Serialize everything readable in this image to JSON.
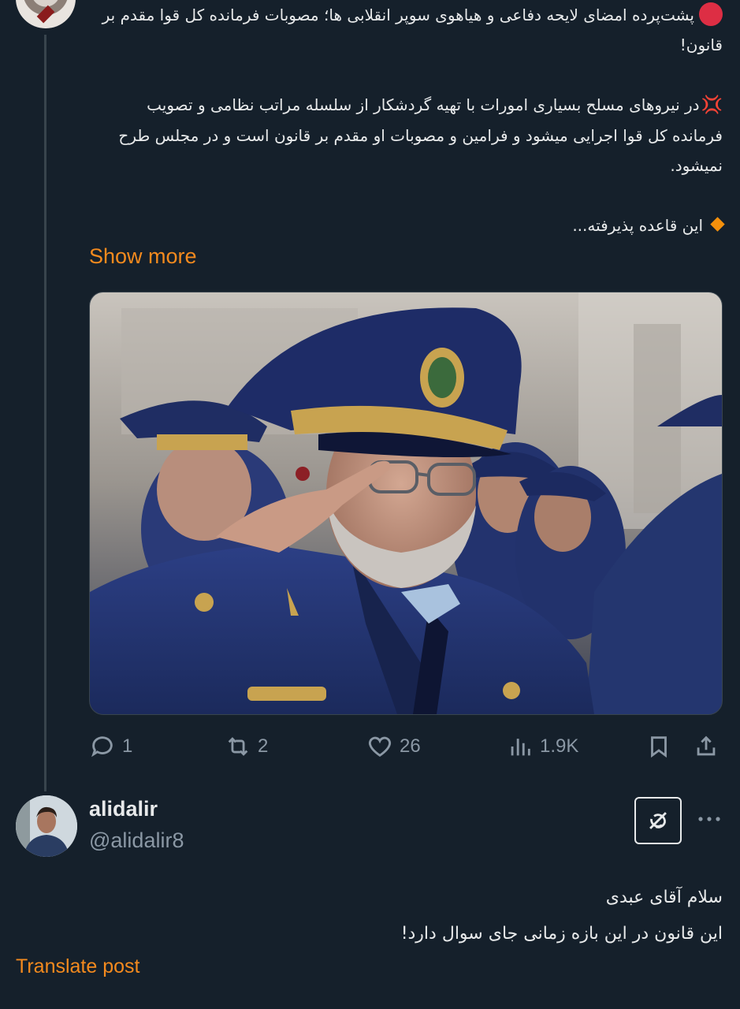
{
  "colors": {
    "background": "#15202b",
    "text": "#e7e9ea",
    "muted": "#8b98a5",
    "accent": "#f48a1e",
    "border": "#38444d"
  },
  "tweet": {
    "lines": [
      "پشت‌پرده امضای لایحه دفاعی و هیاهوی سوپر انقلابی ها؛ مصوبات فرمانده کل قوا مقدم بر قانون!",
      "در نیروهای مسلح بسیاری امورات با تهیه گردشکار از سلسله مراتب نظامی و تصویب فرمانده کل قوا اجرایی میشود و فرامین و مصوبات او مقدم بر قانون است و در مجلس طرح نمیشود.",
      "این قاعده پذیرفته..."
    ],
    "show_more": "Show more",
    "media_icon": "photo-saluting-air-force-officers",
    "actions": {
      "replies": "1",
      "reposts": "2",
      "likes": "26",
      "views": "1.9K"
    },
    "icons": [
      "reply-icon",
      "repost-icon",
      "like-icon",
      "views-icon",
      "bookmark-icon",
      "share-icon"
    ]
  },
  "reply": {
    "display_name": "alidalir",
    "handle": "@alidalir8",
    "lines": [
      "سلام آقای عبدی",
      "این قانون در این بازه زمانی جای سوال دارد!"
    ],
    "translate": "Translate post",
    "icons": [
      "grok-icon",
      "more-icon"
    ]
  }
}
